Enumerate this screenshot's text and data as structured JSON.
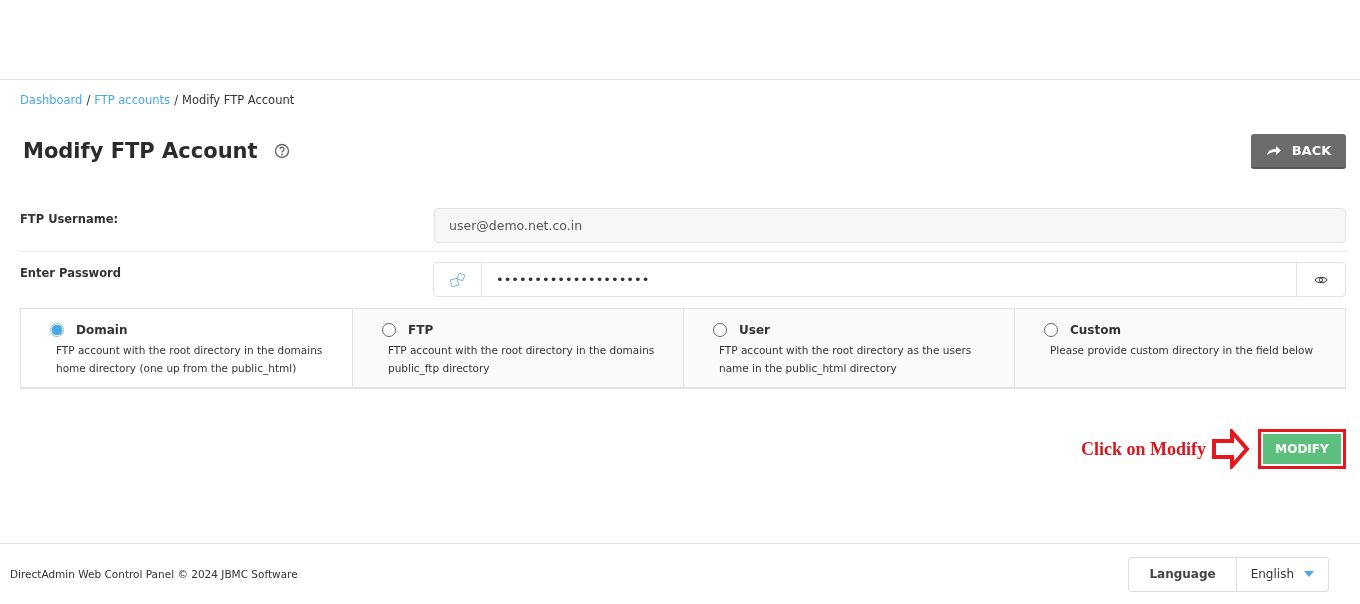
{
  "breadcrumb": [
    {
      "label": "Dashboard",
      "link": true
    },
    {
      "separator": "/",
      "label": "FTP accounts",
      "link": true
    },
    {
      "separator": "/",
      "label": "Modify FTP Account",
      "link": false
    }
  ],
  "page_title": "Modify FTP Account",
  "back_button": "BACK",
  "form": {
    "username": {
      "label": "FTP Username:",
      "value": "user@demo.net.co.in"
    },
    "password": {
      "label": "Enter Password",
      "value": "••••••••••••••••••••"
    }
  },
  "directory_options": [
    {
      "title": "Domain",
      "description": "FTP account with the root directory in the domains home directory (one up from the public_html)",
      "selected": true
    },
    {
      "title": "FTP",
      "description": "FTP account with the root directory in the domains public_ftp directory",
      "selected": false
    },
    {
      "title": "User",
      "description": "FTP account with the root directory as the users name in the public_html directory",
      "selected": false
    },
    {
      "title": "Custom",
      "description": "Please provide custom directory in the field below",
      "selected": false
    }
  ],
  "annotation": {
    "text": "Click on Modify"
  },
  "modify_button": "MODIFY",
  "footer": {
    "copyright": "DirectAdmin Web Control Panel © 2024 JBMC Software",
    "language_label": "Language",
    "language_value": "English"
  }
}
